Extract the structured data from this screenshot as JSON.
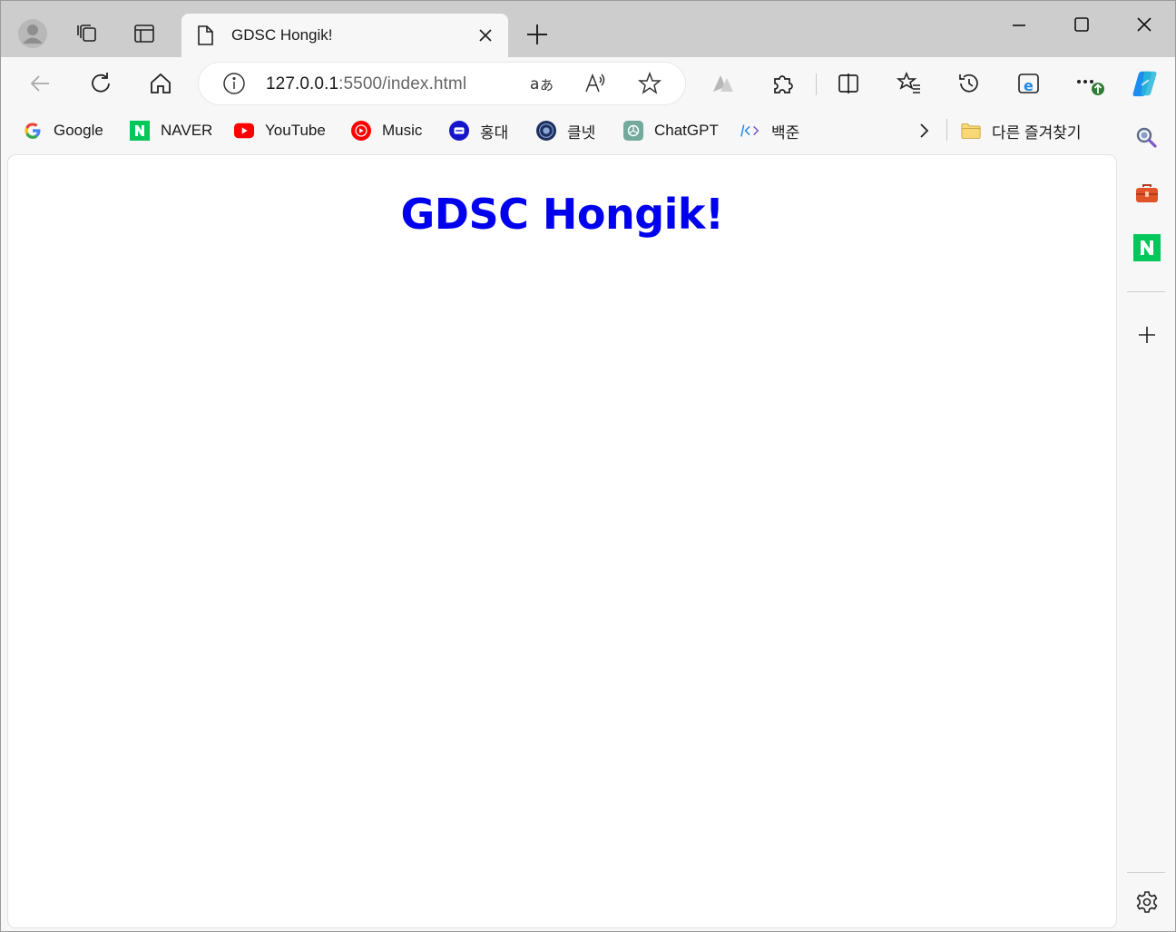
{
  "tab": {
    "title": "GDSC Hongik!"
  },
  "address": {
    "host": "127.0.0.1",
    "rest": ":5500/index.html"
  },
  "bookmarks": [
    {
      "label": "Google",
      "icon": "google-icon"
    },
    {
      "label": "NAVER",
      "icon": "naver-icon"
    },
    {
      "label": "YouTube",
      "icon": "youtube-icon"
    },
    {
      "label": "Music",
      "icon": "youtube-music-icon"
    },
    {
      "label": "홍대",
      "icon": "hongik-icon"
    },
    {
      "label": "클넷",
      "icon": "classnet-icon"
    },
    {
      "label": "ChatGPT",
      "icon": "chatgpt-icon"
    },
    {
      "label": "백준",
      "icon": "code-icon"
    }
  ],
  "other_favorites": {
    "label": "다른 즐겨찾기"
  },
  "page": {
    "heading": "GDSC Hongik!"
  },
  "colors": {
    "link_blue": "#0000ee",
    "naver_green": "#03c75a",
    "youtube_red": "#ff0000",
    "copilot_blue": "#1b8cf0"
  }
}
